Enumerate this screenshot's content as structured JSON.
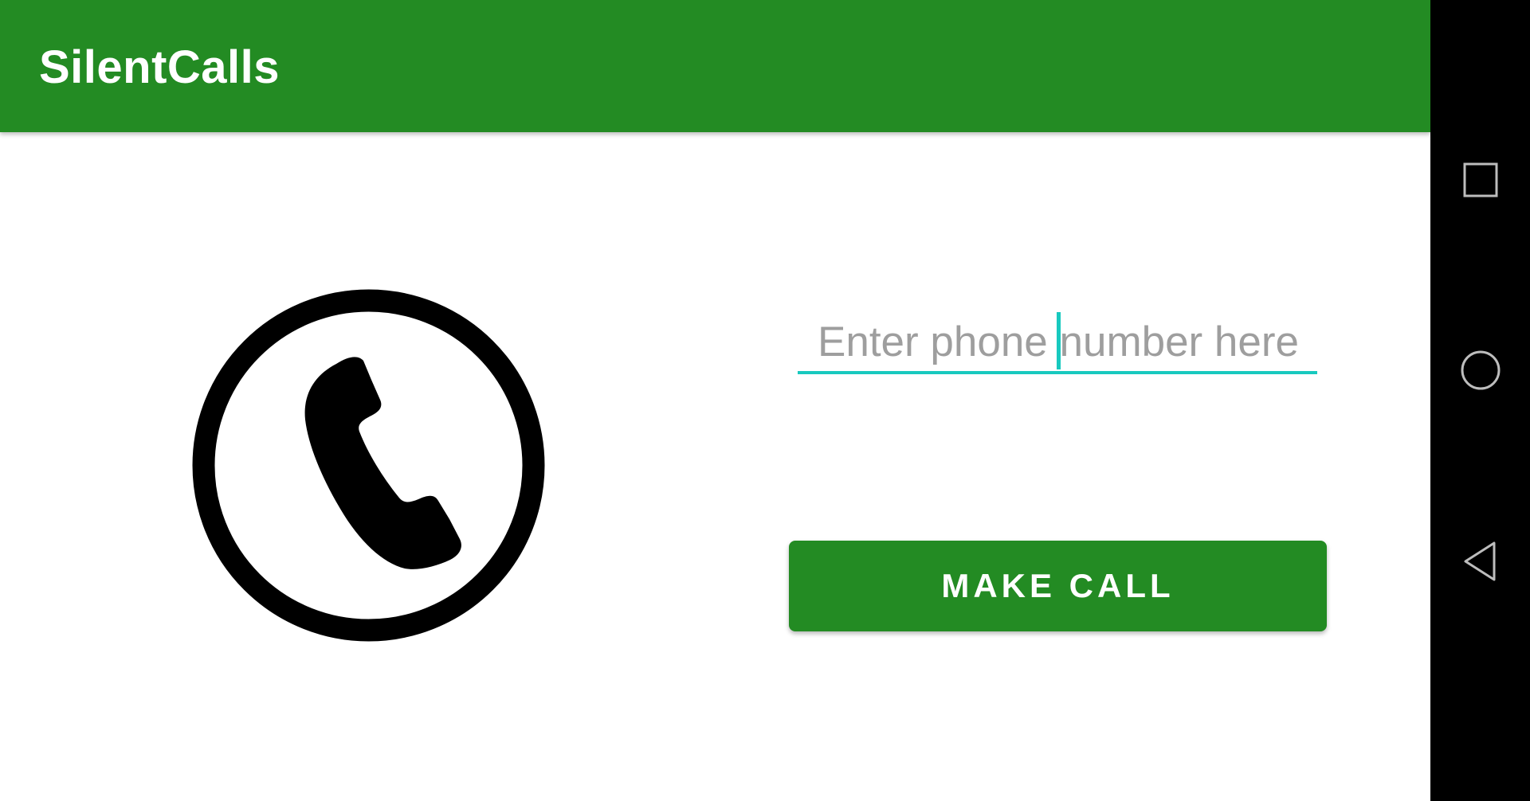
{
  "app": {
    "title": "SilentCalls",
    "accent_color": "#238b23",
    "underline_color": "#18c9bf"
  },
  "main": {
    "phone_input": {
      "value": "",
      "placeholder": "Enter phone number here"
    },
    "make_call_button": {
      "label": "MAKE CALL"
    },
    "call_icon": "phone-in-circle-icon"
  },
  "nav_bar": {
    "buttons": [
      {
        "name": "recents",
        "icon": "square-icon"
      },
      {
        "name": "home",
        "icon": "circle-icon"
      },
      {
        "name": "back",
        "icon": "triangle-back-icon"
      }
    ]
  }
}
